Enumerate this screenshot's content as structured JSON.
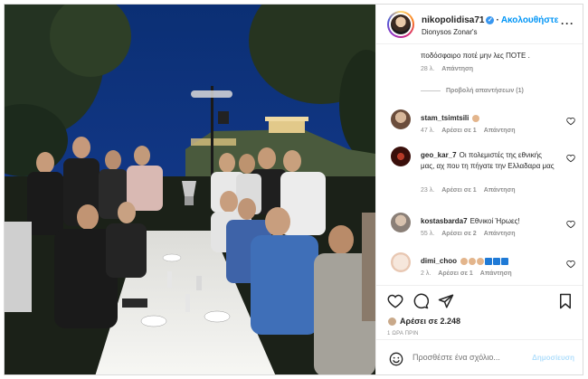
{
  "post": {
    "username": "nikopolidisa71",
    "follow_label": "Ακολουθήστε",
    "location": "Dionysos Zonar's",
    "more_icon": "ellipsis-icon",
    "photo_alt": "",
    "photo_colors": {
      "sky": "#0d2b63",
      "ground": "#1d2a22",
      "table": "#f2f2ef",
      "acropolis": "#e2c98a"
    }
  },
  "comments": {
    "previous": {
      "text": "ποδόσφαιρο ποτέ μην λες ΠΟΤΕ .",
      "time": "28 λ.",
      "reply_label": "Απάντηση"
    },
    "view_replies": "Προβολή απαντήσεων (1)",
    "items": [
      {
        "user": "stam_tsimtsili",
        "text": "",
        "emoji": "clap",
        "time": "47 λ.",
        "likes": "Αρέσει σε 1",
        "reply": "Απάντηση",
        "avatar_color": "#8a6a58"
      },
      {
        "user": "geo_kar_7",
        "text": "Οι πολεμιστές της εθνικής μας, αχ που τη πήγατε την Ελλαδαρα μας",
        "time": "23 λ.",
        "likes": "Αρέσει σε 1",
        "reply": "Απάντηση",
        "avatar_color": "#5a1a14"
      },
      {
        "user": "kostasbarda7",
        "text": "Εθνικοί Ήρωες!",
        "time": "55 λ.",
        "likes": "Αρέσει σε 2",
        "reply": "Απάντηση",
        "avatar_color": "#9a8f86"
      },
      {
        "user": "dimi_choo",
        "text": "",
        "emoji": "hands-and-flags",
        "time": "2 λ.",
        "likes": "Αρέσει σε 1",
        "reply": "Απάντηση",
        "avatar_color": "#f1dccf"
      }
    ]
  },
  "actions": {
    "like_icon": "heart-icon",
    "comment_icon": "comment-icon",
    "share_icon": "send-icon",
    "save_icon": "bookmark-icon",
    "likes_text": "Αρέσει σε 2.248",
    "time_ago": "1 ΩΡΑ ΠΡΙΝ"
  },
  "add_comment": {
    "placeholder": "Προσθέστε ένα σχόλιο...",
    "post_label": "Δημοσίευση",
    "emoji_icon": "smiley-icon"
  },
  "colors": {
    "accent": "#0095f6",
    "muted": "#8e8e8e",
    "text": "#262626",
    "post_disabled": "#b2dffc"
  }
}
